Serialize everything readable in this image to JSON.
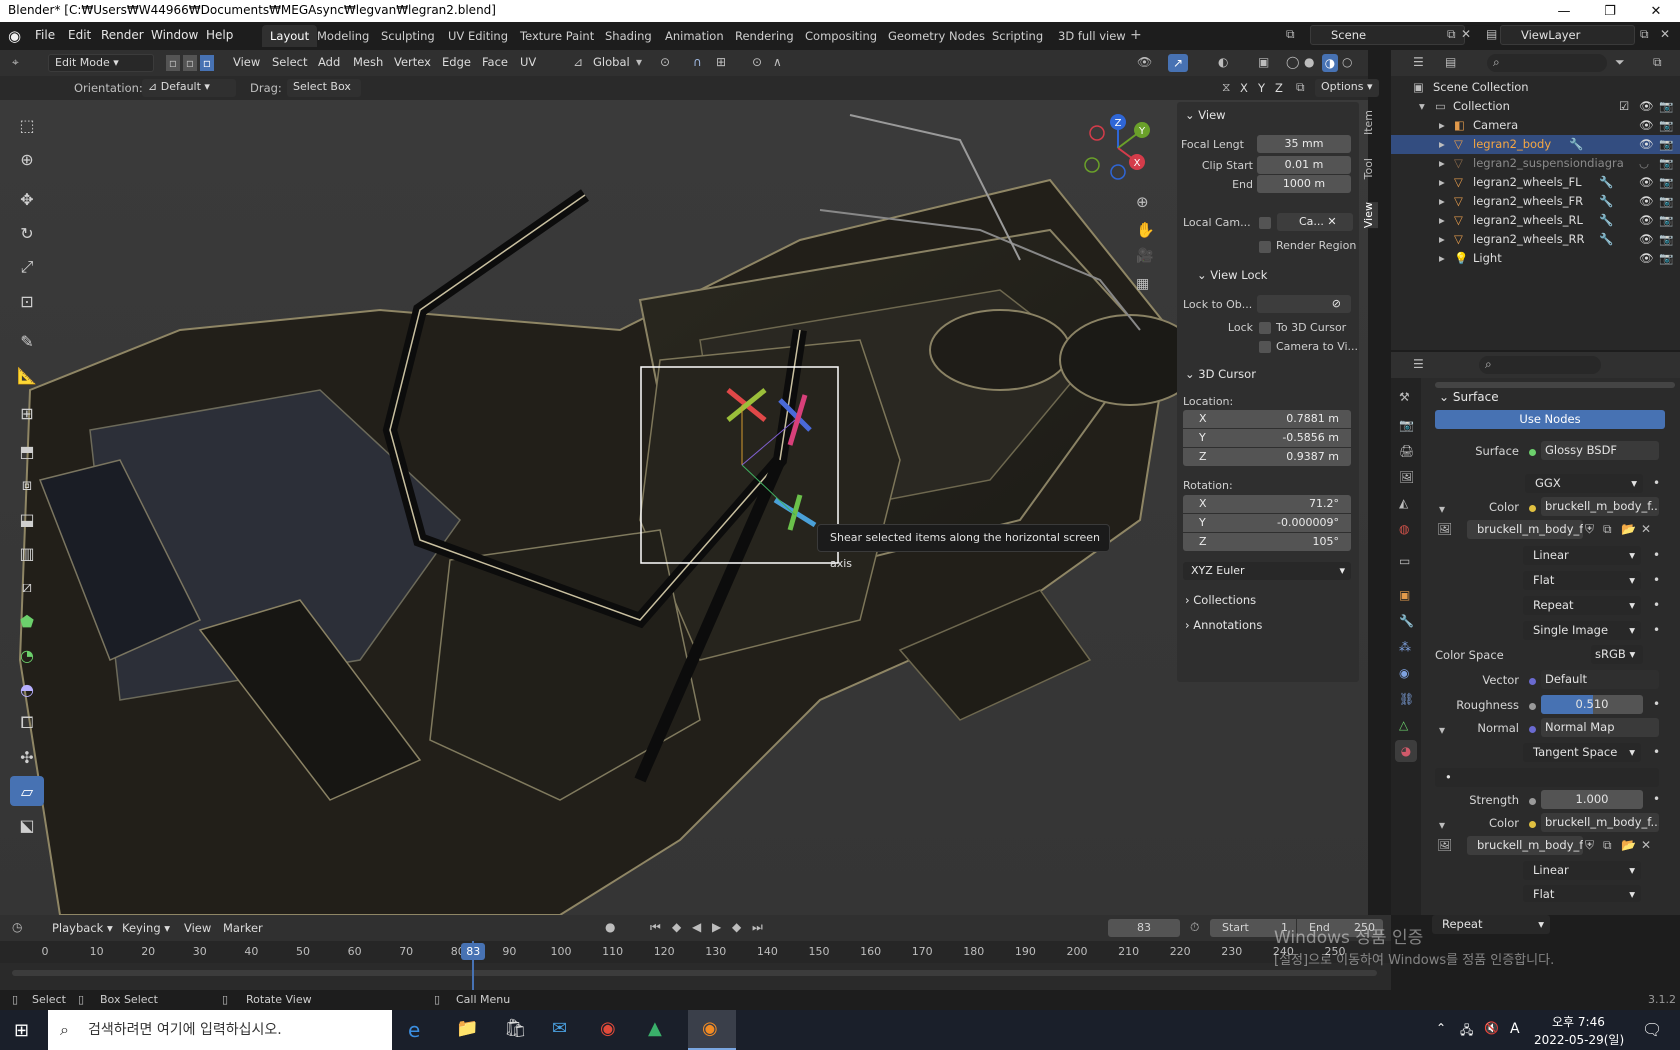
{
  "window": {
    "title": "Blender* [C:₩Users₩W44966₩Documents₩MEGAsync₩legvan₩legran2.blend]"
  },
  "topmenu": {
    "items": [
      "File",
      "Edit",
      "Render",
      "Window",
      "Help"
    ]
  },
  "workspaces": [
    "Layout",
    "Modeling",
    "Sculpting",
    "UV Editing",
    "Texture Paint",
    "Shading",
    "Animation",
    "Rendering",
    "Compositing",
    "Geometry Nodes",
    "Scripting",
    "3D full view"
  ],
  "scene": {
    "name": "Scene",
    "viewlayer": "ViewLayer"
  },
  "header": {
    "mode": "Edit Mode",
    "menus": [
      "View",
      "Select",
      "Add",
      "Mesh",
      "Vertex",
      "Edge",
      "Face",
      "UV"
    ],
    "transform": "Global",
    "orientation_label": "Orientation:",
    "orientation_value": "Default",
    "drag_label": "Drag:",
    "drag_value": "Select Box",
    "axes": [
      "X",
      "Y",
      "Z"
    ],
    "options": "Options"
  },
  "gizmo": {
    "x": "X",
    "y": "Y",
    "z": "Z"
  },
  "tooltip": "Shear selected items along the horizontal screen axis",
  "npanel": {
    "tabs": [
      "Item",
      "Tool",
      "View"
    ],
    "view_title": "View",
    "focal_label": "Focal Lengt",
    "focal_value": "35 mm",
    "clip_start_label": "Clip Start",
    "clip_start_value": "0.01 m",
    "end_label": "End",
    "end_value": "1000 m",
    "local_cam_label": "Local Cam...",
    "local_cam_value": "Ca...",
    "render_region": "Render Region",
    "view_lock_title": "View Lock",
    "lock_to_obj_label": "Lock to Ob...",
    "lock_label": "Lock",
    "to_3d_cursor": "To 3D Cursor",
    "camera_to_view": "Camera to Vi...",
    "cursor_title": "3D Cursor",
    "location_label": "Location:",
    "loc_x": "0.7881 m",
    "loc_y": "-0.5856 m",
    "loc_z": "0.9387 m",
    "rotation_label": "Rotation:",
    "rot_x": "71.2°",
    "rot_y": "-0.000009°",
    "rot_z": "105°",
    "rot_mode": "XYZ Euler",
    "collections": "Collections",
    "annotations": "Annotations",
    "axis_x": "X",
    "axis_y": "Y",
    "axis_z": "Z"
  },
  "outliner": {
    "scene_collection": "Scene Collection",
    "items": [
      {
        "name": "Collection"
      },
      {
        "name": "Camera"
      },
      {
        "name": "legran2_body"
      },
      {
        "name": "legran2_suspensiondiagram"
      },
      {
        "name": "legran2_wheels_FL"
      },
      {
        "name": "legran2_wheels_FR"
      },
      {
        "name": "legran2_wheels_RL"
      },
      {
        "name": "legran2_wheels_RR"
      },
      {
        "name": "Light"
      }
    ]
  },
  "properties": {
    "surface_title": "Surface",
    "use_nodes": "Use Nodes",
    "surface_label": "Surface",
    "surface_value": "Glossy BSDF",
    "distribution": "GGX",
    "color_label": "Color",
    "color_value": "bruckell_m_body_f...",
    "image_name": "bruckell_m_body_fr...",
    "interp": "Linear",
    "projection": "Flat",
    "extension": "Repeat",
    "source": "Single Image",
    "colorspace_label": "Color Space",
    "colorspace_value": "sRGB",
    "vector_label": "Vector",
    "vector_value": "Default",
    "roughness_label": "Roughness",
    "roughness_value": "0.510",
    "roughness_fraction": 0.51,
    "normal_label": "Normal",
    "normal_value": "Normal Map",
    "tangent": "Tangent Space",
    "strength_label": "Strength",
    "strength_value": "1.000",
    "color2_label": "Color",
    "color2_value": "bruckell_m_body_f...",
    "image2_name": "bruckell_m_body_fr...",
    "interp2": "Linear",
    "projection2": "Flat",
    "extension2": "Repeat"
  },
  "timeline": {
    "menus": [
      "Playback",
      "Keying",
      "View",
      "Marker"
    ],
    "current_frame": "83",
    "start_label": "Start",
    "start_value": "1",
    "end_label": "End",
    "end_value": "250",
    "ticks": [
      "0",
      "10",
      "20",
      "30",
      "40",
      "50",
      "60",
      "70",
      "80",
      "90",
      "100",
      "110",
      "120",
      "130",
      "140",
      "150",
      "160",
      "170",
      "180",
      "190",
      "200",
      "210",
      "220",
      "230",
      "240",
      "250"
    ]
  },
  "watermark": {
    "line1": "Windows 정품 인증",
    "line2": "[설정]으로 이동하여 Windows를 정품 인증합니다."
  },
  "statusbar": {
    "select": "Select",
    "box_select": "Box Select",
    "rotate_view": "Rotate View",
    "call_menu": "Call Menu",
    "version": "3.1.2"
  },
  "taskbar": {
    "search_placeholder": "검색하려면 여기에 입력하십시오.",
    "time": "오후 7:46",
    "date": "2022-05-29(일)",
    "ime": "A"
  },
  "colors": {
    "accent": "#4772b3",
    "selected_object": "#f5a742",
    "header": "#303030"
  }
}
